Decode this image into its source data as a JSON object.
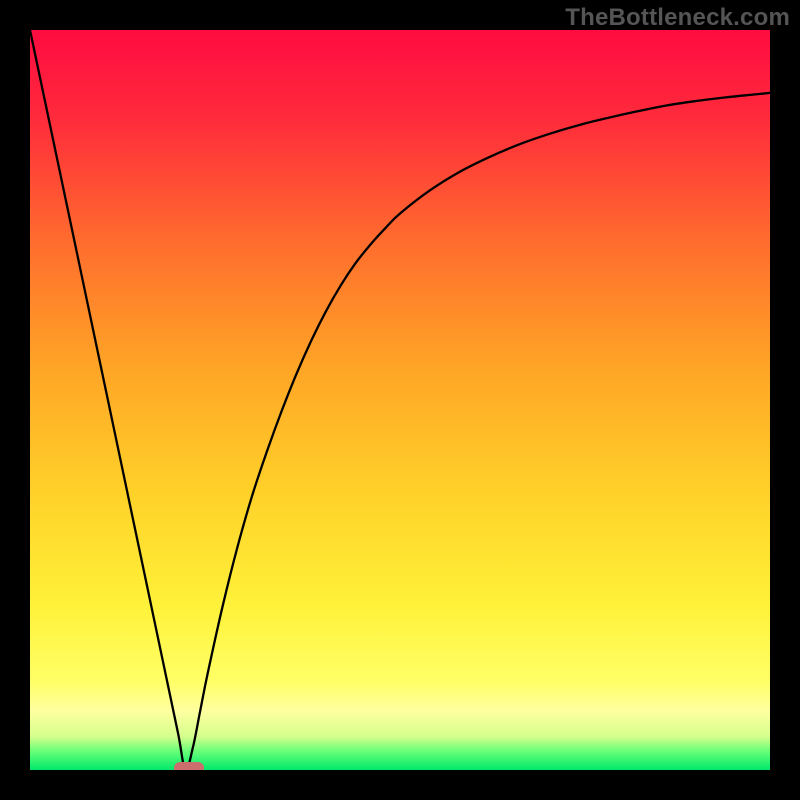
{
  "watermark": "TheBottleneck.com",
  "chart_data": {
    "type": "line",
    "title": "",
    "xlabel": "",
    "ylabel": "",
    "xlim": [
      0,
      100
    ],
    "ylim": [
      0,
      100
    ],
    "legend": false,
    "grid": false,
    "background_gradient": {
      "stops": [
        {
          "pos": 0.0,
          "color": "#ff0b41"
        },
        {
          "pos": 0.12,
          "color": "#ff2b3b"
        },
        {
          "pos": 0.28,
          "color": "#ff6a2e"
        },
        {
          "pos": 0.45,
          "color": "#ffa326"
        },
        {
          "pos": 0.62,
          "color": "#ffd028"
        },
        {
          "pos": 0.78,
          "color": "#fff23a"
        },
        {
          "pos": 0.88,
          "color": "#ffff66"
        },
        {
          "pos": 0.92,
          "color": "#ffffa0"
        },
        {
          "pos": 0.955,
          "color": "#d4ff8c"
        },
        {
          "pos": 0.975,
          "color": "#66ff78"
        },
        {
          "pos": 1.0,
          "color": "#00e86a"
        }
      ]
    },
    "series": [
      {
        "name": "curve",
        "color": "#000000",
        "x": [
          0,
          2,
          4,
          6,
          8,
          10,
          12,
          14,
          16,
          18,
          20,
          21,
          22,
          23,
          24,
          26,
          28,
          30,
          32,
          34,
          36,
          38,
          40,
          42,
          44,
          46,
          48,
          50,
          54,
          58,
          62,
          66,
          70,
          74,
          78,
          82,
          86,
          90,
          94,
          98,
          100
        ],
        "y": [
          100,
          90.5,
          81.0,
          71.5,
          62.0,
          52.5,
          43.0,
          33.5,
          24.0,
          14.5,
          5.0,
          0.0,
          3.0,
          8.0,
          13.0,
          22.0,
          30.0,
          37.0,
          43.0,
          48.5,
          53.5,
          58.0,
          62.0,
          65.5,
          68.5,
          71.0,
          73.2,
          75.2,
          78.3,
          80.8,
          82.8,
          84.5,
          85.9,
          87.1,
          88.1,
          89.0,
          89.8,
          90.4,
          90.9,
          91.3,
          91.5
        ]
      }
    ],
    "minimum_marker": {
      "x_start": 19.5,
      "x_end": 23.5,
      "y": 0
    }
  }
}
